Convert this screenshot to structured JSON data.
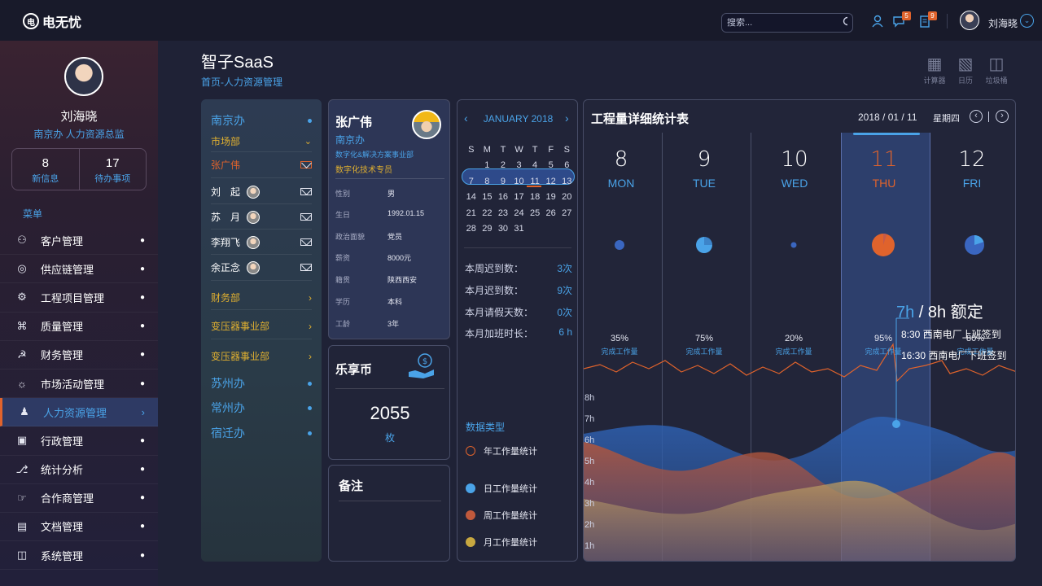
{
  "topbar": {
    "logo": "电无忧",
    "search_placeholder": "搜索...",
    "msg_badge": "5",
    "task_badge": "9",
    "user": "刘海晓"
  },
  "sidebar": {
    "name": "刘海晓",
    "role": "南京办  人力资源总监",
    "stats": [
      {
        "n": "8",
        "l": "新信息"
      },
      {
        "n": "17",
        "l": "待办事项"
      }
    ],
    "menu_title": "菜单",
    "items": [
      {
        "label": "客户管理",
        "icon": "customers-icon"
      },
      {
        "label": "供应链管理",
        "icon": "supply-chain-icon"
      },
      {
        "label": "工程项目管理",
        "icon": "project-gear-icon"
      },
      {
        "label": "质量管理",
        "icon": "quality-icon"
      },
      {
        "label": "财务管理",
        "icon": "finance-icon"
      },
      {
        "label": "市场活动管理",
        "icon": "bulb-icon"
      },
      {
        "label": "人力资源管理",
        "icon": "hr-icon"
      },
      {
        "label": "行政管理",
        "icon": "briefcase-icon"
      },
      {
        "label": "统计分析",
        "icon": "stats-icon"
      },
      {
        "label": "合作商管理",
        "icon": "handshake-icon"
      },
      {
        "label": "文档管理",
        "icon": "document-icon"
      },
      {
        "label": "系统管理",
        "icon": "system-icon"
      }
    ]
  },
  "page": {
    "title": "智子SaaS",
    "breadcrumb": "首页-人力资源管理"
  },
  "tools": [
    {
      "label": "计算器",
      "icon": "calculator-icon"
    },
    {
      "label": "日历",
      "icon": "calendar-icon"
    },
    {
      "label": "垃圾桶",
      "icon": "trash-icon"
    }
  ],
  "org": {
    "office": "南京办",
    "dept": "市场部",
    "selected": "张广伟",
    "people": [
      "刘　起",
      "苏　月",
      "李翔飞",
      "余正念"
    ],
    "d1": "财务部",
    "d2": "变压器事业部",
    "d3": "变压器事业部",
    "others": [
      "苏州办",
      "常州办",
      "宿迁办"
    ]
  },
  "person": {
    "name": "张广伟",
    "office": "南京办",
    "dept": "数字化&解决方案事业部",
    "title": "数字化技术专员",
    "fields": [
      {
        "k": "性别",
        "v": "男"
      },
      {
        "k": "生日",
        "v": "1992.01.15"
      },
      {
        "k": "政治面貌",
        "v": "党员"
      },
      {
        "k": "薪资",
        "v": "8000元"
      },
      {
        "k": "籍贯",
        "v": "陕西西安"
      },
      {
        "k": "学历",
        "v": "本科"
      },
      {
        "k": "工龄",
        "v": "3年"
      }
    ]
  },
  "coin": {
    "title": "乐享币",
    "amount": "2055",
    "unit": "枚"
  },
  "note": {
    "title": "备注"
  },
  "calendar": {
    "month": "JANUARY 2018",
    "weekdays": [
      "S",
      "M",
      "T",
      "W",
      "T",
      "F",
      "S"
    ],
    "weeks": [
      [
        "",
        "1",
        "2",
        "3",
        "4",
        "5",
        "6"
      ],
      [
        "7",
        "8",
        "9",
        "10",
        "11",
        "12",
        "13"
      ],
      [
        "14",
        "15",
        "16",
        "17",
        "18",
        "19",
        "20"
      ],
      [
        "21",
        "22",
        "23",
        "24",
        "25",
        "26",
        "27"
      ],
      [
        "28",
        "29",
        "30",
        "31",
        "",
        "",
        ""
      ]
    ],
    "attendance": [
      {
        "k": "本周迟到数：",
        "v": "3次"
      },
      {
        "k": "本月迟到数：",
        "v": "9次"
      },
      {
        "k": "本月请假天数：",
        "v": "0次"
      },
      {
        "k": "本月加班时长：",
        "v": "6 h"
      }
    ],
    "types_title": "数据类型",
    "types": [
      {
        "label": "年工作量统计",
        "color": "#e0632c",
        "ring": true
      },
      {
        "label": "日工作量统计",
        "color": "#4aa3e8"
      },
      {
        "label": "周工作量统计",
        "color": "#c0593c"
      },
      {
        "label": "月工作量统计",
        "color": "#c8a840"
      }
    ]
  },
  "workload": {
    "title": "工程量详细统计表",
    "date": "2018 / 01 / 11",
    "weekday": "星期四",
    "days": [
      {
        "n": "8",
        "w": "MON",
        "pct": "35%",
        "f": 0.35
      },
      {
        "n": "9",
        "w": "TUE",
        "pct": "75%",
        "f": 0.75
      },
      {
        "n": "10",
        "w": "WED",
        "pct": "20%",
        "f": 0.2
      },
      {
        "n": "11",
        "w": "THU",
        "pct": "95%",
        "f": 0.95,
        "active": true
      },
      {
        "n": "12",
        "w": "FRI",
        "pct": "80%",
        "f": 0.8
      }
    ],
    "caption": "完成工作量",
    "tip_actual": "7h",
    "tip_rest": " / 8h 额定",
    "tip1": "8:30 西南电厂上班签到",
    "tip2": "16:30 西南电厂下班签到",
    "ylabels": [
      "8h",
      "7h",
      "6h",
      "5h",
      "4h",
      "3h",
      "2h",
      "1h"
    ]
  }
}
